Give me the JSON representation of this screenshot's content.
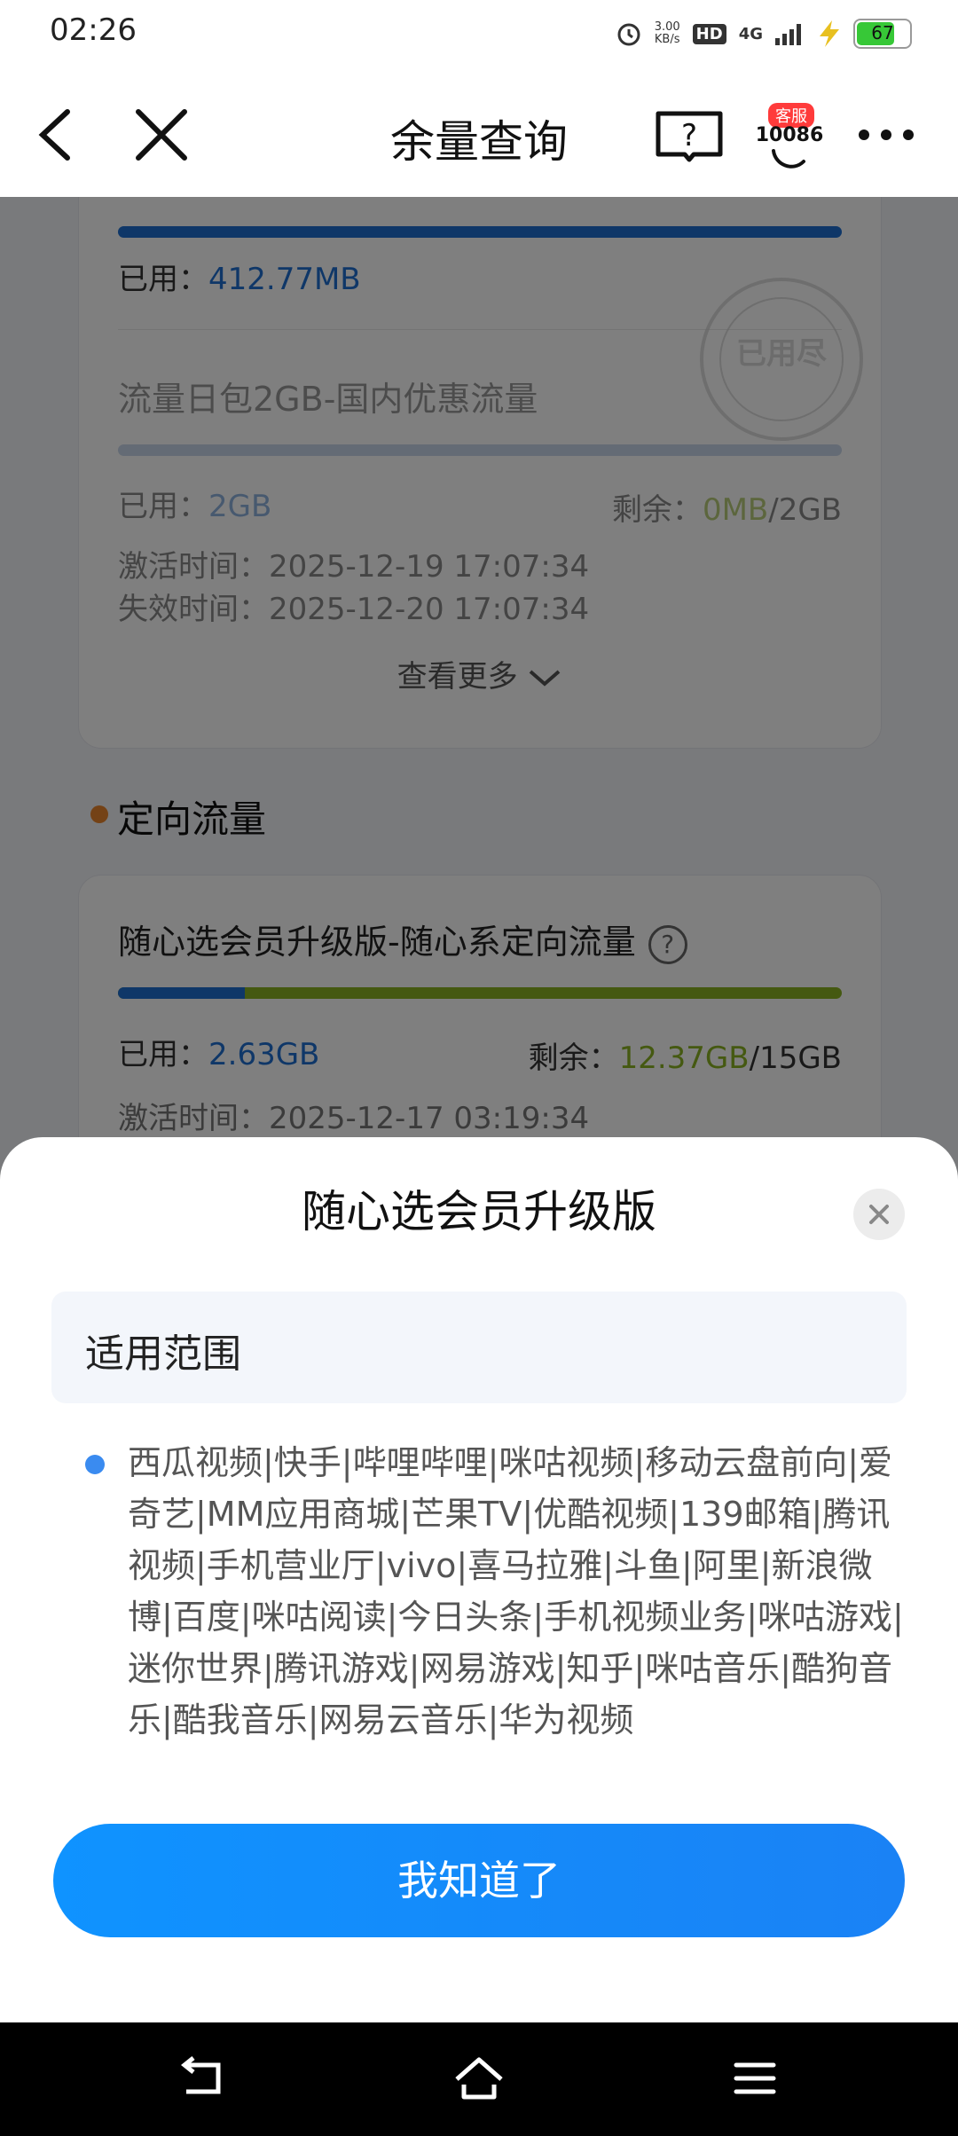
{
  "status_bar": {
    "time": "02:26",
    "speed": "3.00",
    "speed_unit": "KB/s",
    "hd": "HD",
    "network": "4G",
    "battery": "67"
  },
  "navbar": {
    "title": "余量查询",
    "service_tag": "客服",
    "service_number": "10086"
  },
  "card1": {
    "used_label": "已用：",
    "used_value": "412.77MB",
    "item2_name": "流量日包2GB-国内优惠流量",
    "item2_used_label": "已用：",
    "item2_used_value": "2GB",
    "item2_remain_label": "剩余：",
    "item2_remain_value": "0MB",
    "item2_total": "/2GB",
    "stamp_text": "已用尽",
    "activate_label": "激活时间：",
    "activate_time": "2025-12-19 17:07:34",
    "expire_label": "失效时间：",
    "expire_time": "2025-12-20 17:07:34",
    "view_more": "查看更多"
  },
  "section_title": "定向流量",
  "card2": {
    "name": "随心选会员升级版-随心系定向流量",
    "help_icon": "?",
    "used_label": "已用：",
    "used_value": "2.63GB",
    "remain_label": "剩余：",
    "remain_value": "12.37GB",
    "total": "/15GB",
    "used_fraction": 0.175,
    "activate_label": "激活时间：",
    "activate_time": "2025-12-17 03:19:34"
  },
  "sheet": {
    "title": "随心选会员升级版",
    "scope_label": "适用范围",
    "apps": "西瓜视频|快手|哔哩哔哩|咪咕视频|移动云盘前向|爱奇艺|MM应用商城|芒果TV|优酷视频|139邮箱|腾讯视频|手机营业厅|vivo|喜马拉雅|斗鱼|阿里|新浪微博|百度|咪咕阅读|今日头条|手机视频业务|咪咕游戏|迷你世界|腾讯游戏|网易游戏|知乎|咪咕音乐|酷狗音乐|酷我音乐|网易云音乐|华为视频",
    "confirm_button": "我知道了"
  },
  "colors": {
    "accent_blue": "#1f6fd1",
    "remain_green": "#8bb322",
    "button_blue": "#1a8cff"
  }
}
